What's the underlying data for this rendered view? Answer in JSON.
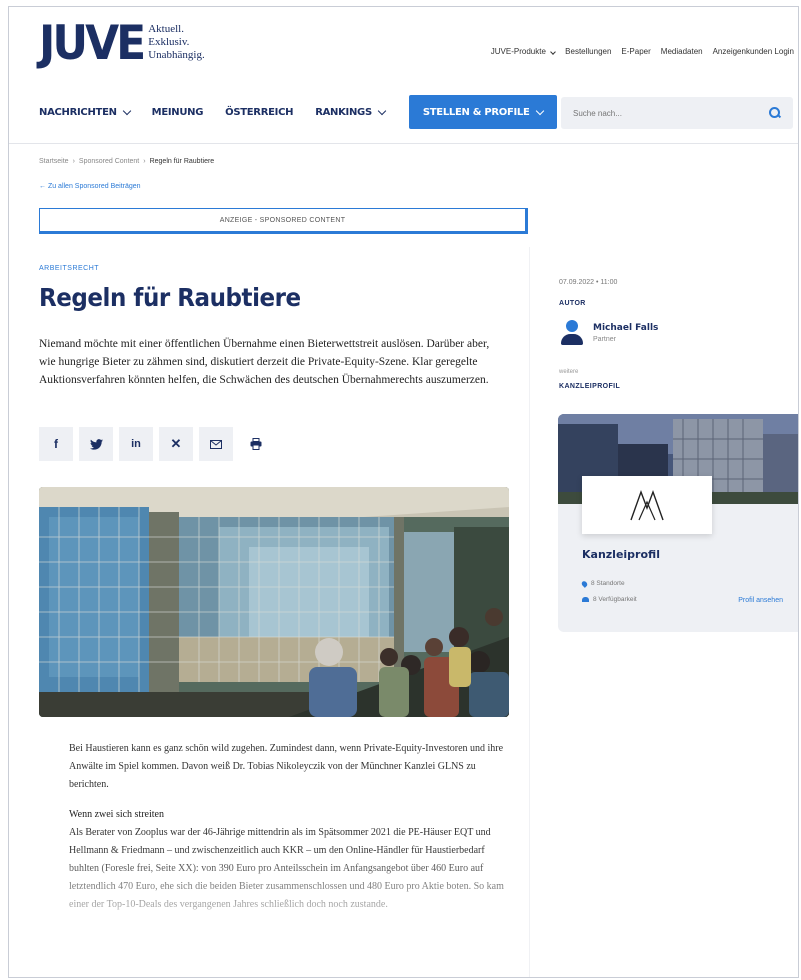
{
  "brand": {
    "logo": "JUVE",
    "tagline": [
      "Aktuell.",
      "Exklusiv.",
      "Unabhängig."
    ],
    "accent": "#2b7ad6",
    "navy": "#1c2f63"
  },
  "topnav": [
    "JUVE-Produkte",
    "Bestellungen",
    "E-Paper",
    "Mediadaten",
    "Anzeigenkunden Login"
  ],
  "mainnav": {
    "items": [
      "NACHRICHTEN",
      "MEINUNG",
      "ÖSTERREICH",
      "RANKINGS"
    ],
    "cta": "STELLEN & PROFILE"
  },
  "search": {
    "placeholder": "Suche nach..."
  },
  "breadcrumb": [
    "Startseite",
    "Sponsored Content",
    "Regeln für Raubtiere"
  ],
  "back_link": "← Zu allen Sponsored Beiträgen",
  "sponsor_label": "ANZEIGE - SPONSORED CONTENT",
  "article": {
    "category": "ARBEITSRECHT",
    "title": "Regeln für Raubtiere",
    "lead": "Niemand möchte mit einer öffentlichen Übernahme einen Bieterwettstreit auslösen. Darüber aber, wie hungrige Bieter zu zähmen sind, diskutiert derzeit die Private-Equity-Szene. Klar geregelte Auktionsverfahren könnten helfen, die Schwächen des deutschen Übernahmerechts auszumerzen.",
    "share_icons": [
      "facebook-icon",
      "twitter-icon",
      "linkedin-icon",
      "xing-icon",
      "mail-icon",
      "print-icon"
    ],
    "paragraph1": "Bei Haustieren kann es ganz schön wild zugehen. Zumindest dann, wenn Private-Equity-Investoren und ihre Anwälte im Spiel kommen. Davon weiß Dr. Tobias Nikoleyczik von der Münchner Kanzlei GLNS zu berichten.",
    "subheading": "Wenn zwei sich streiten",
    "paragraph2": "Als Berater von Zooplus war der 46-Jährige mittendrin als im Spätsommer 2021 die PE-Häuser EQT und Hellmann & Friedmann – und zwischenzeitlich auch KKR – um den Online-Händler für Haustierbedarf buhlten (Foresle frei, Seite XX): von 390 Euro pro Anteilsschein im Anfangsangebot über 460 Euro auf letztendlich 470 Euro, ehe sich die beiden Bieter zusammenschlossen und 480 Euro pro Aktie boten. So kam einer der Top-10-Deals des vergangenen Jahres schließlich doch noch zustande."
  },
  "sidebar": {
    "date": "07.09.2022 • 11:00",
    "author_heading": "AUTOR",
    "author_name": "Michael Falls",
    "author_role": "Partner",
    "small_label": "weitere",
    "kanzlei_heading": "KANZLEIPROFIL",
    "card": {
      "title": "Kanzleiprofil",
      "meta1": "8 Standorte",
      "meta2": "8 Verfügbarkeit",
      "link": "Profil ansehen"
    }
  }
}
